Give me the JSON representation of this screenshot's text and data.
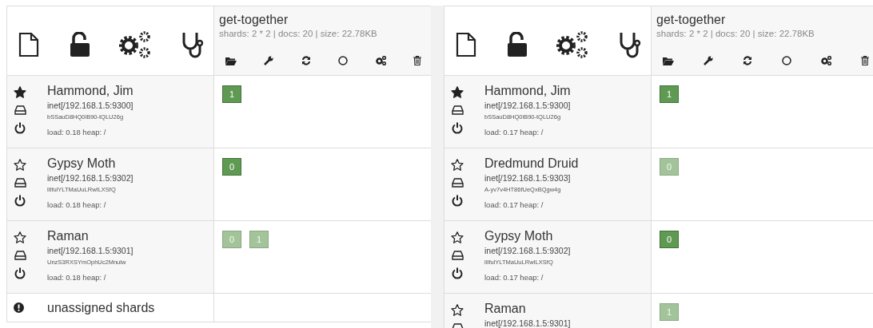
{
  "panels": [
    {
      "index": {
        "name": "get-together",
        "stats": "shards: 2 * 2 | docs: 20 | size: 22.78KB"
      },
      "nodes": [
        {
          "name": "Hammond, Jim",
          "address": "inet[/192.168.1.5:9300]",
          "id": "bSSauD8HQ0iB90-tQLU26g",
          "stats": "load: 0.18  heap: /",
          "master": true,
          "shards": [
            {
              "label": "1",
              "primary": true
            }
          ]
        },
        {
          "name": "Gypsy Moth",
          "address": "inet[/192.168.1.5:9302]",
          "id": "lIlfulYLTMaUuLRwILXSfQ",
          "stats": "load: 0.18  heap: /",
          "master": false,
          "shards": [
            {
              "label": "0",
              "primary": true
            }
          ]
        },
        {
          "name": "Raman",
          "address": "inet[/192.168.1.5:9301]",
          "id": "UnzS3RXSYmOphUc2Mnulw",
          "stats": "load: 0.18  heap: /",
          "master": false,
          "shards": [
            {
              "label": "0",
              "primary": false
            },
            {
              "label": "1",
              "primary": false
            }
          ]
        }
      ],
      "unassigned": {
        "label": "unassigned shards"
      }
    },
    {
      "index": {
        "name": "get-together",
        "stats": "shards: 2 * 2 | docs: 20 | size: 22.78KB"
      },
      "nodes": [
        {
          "name": "Hammond, Jim",
          "address": "inet[/192.168.1.5:9300]",
          "id": "bSSauD8HQ0iB90-tQLU26g",
          "stats": "load: 0.17  heap: /",
          "master": true,
          "shards": [
            {
              "label": "1",
              "primary": true
            }
          ]
        },
        {
          "name": "Dredmund Druid",
          "address": "inet[/192.168.1.5:9303]",
          "id": "A-yv7v4HT86fUeQxBQgw4g",
          "stats": "load: 0.17  heap: /",
          "master": false,
          "shards": [
            {
              "label": "0",
              "primary": false
            }
          ]
        },
        {
          "name": "Gypsy Moth",
          "address": "inet[/192.168.1.5:9302]",
          "id": "lIlfulYLTMaUuLRwILXSfQ",
          "stats": "load: 0.17  heap: /",
          "master": false,
          "shards": [
            {
              "label": "0",
              "primary": true
            }
          ]
        },
        {
          "name": "Raman",
          "address": "inet[/192.168.1.5:9301]",
          "master": false,
          "shards": [
            {
              "label": "1",
              "primary": false
            }
          ]
        }
      ]
    }
  ]
}
